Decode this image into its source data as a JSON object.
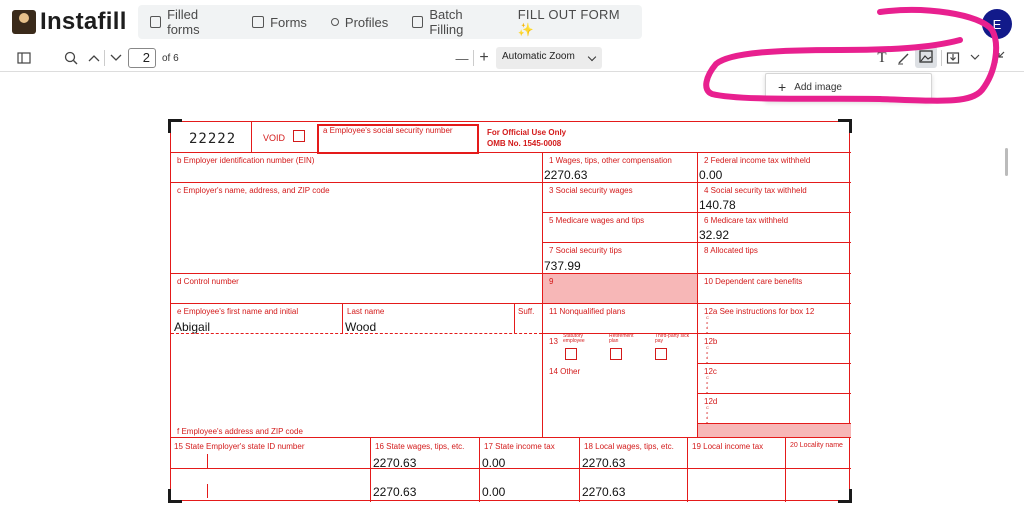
{
  "app": {
    "brand": "Instafill"
  },
  "nav": {
    "items": [
      {
        "label": "Filled forms"
      },
      {
        "label": "Forms"
      },
      {
        "label": "Profiles"
      },
      {
        "label": "Batch Filling"
      },
      {
        "label": "FILL OUT FORM ✨"
      }
    ]
  },
  "user": {
    "initial": "E"
  },
  "viewer": {
    "page": "2",
    "page_total": "of 6",
    "zoom": "Automatic Zoom",
    "popup_label": "Add image",
    "zoom_out": "—",
    "zoom_in": "+"
  },
  "form": {
    "code": "22222",
    "void_label": "VOID",
    "ssn_label": "a  Employee's social security number",
    "official_line1": "For Official Use Only",
    "official_line2": "OMB No. 1545-0008",
    "labels": {
      "b": "b  Employer identification number (EIN)",
      "c": "c  Employer's name, address, and ZIP code",
      "d": "d  Control number",
      "e": "e  Employee's first name and initial",
      "last": "Last name",
      "suff": "Suff.",
      "f": "f  Employee's address and ZIP code",
      "box1": "1   Wages, tips, other compensation",
      "box2": "2   Federal income tax withheld",
      "box3": "3   Social security wages",
      "box4": "4   Social security tax withheld",
      "box5": "5   Medicare wages and tips",
      "box6": "6   Medicare tax withheld",
      "box7": "7   Social security tips",
      "box8": "8   Allocated tips",
      "box9": "9",
      "box10": "10   Dependent care benefits",
      "box11": "11   Nonqualified plans",
      "box12a": "12a  See instructions for box 12",
      "box12b": "12b",
      "box12c": "12c",
      "box12d": "12d",
      "box13": "13",
      "statutory": "Statutory employee",
      "retirement": "Retirement plan",
      "thirdparty": "Third-party sick pay",
      "box14": "14  Other",
      "box15": "15  State    Employer's state ID number",
      "box16": "16  State wages, tips, etc.",
      "box17": "17  State income tax",
      "box18": "18  Local wages, tips, etc.",
      "box19": "19  Local income tax",
      "box20": "20  Locality name",
      "code_letters": "C o d e"
    },
    "values": {
      "box1": "2270.63",
      "box2": "0.00",
      "box4": "140.78",
      "box6": "32.92",
      "box7": "737.99",
      "first_name": "Abigail",
      "last_name": "Wood",
      "box16_row1": "2270.63",
      "box17_row1": "0.00",
      "box18_row1": "2270.63",
      "box16_row2": "2270.63",
      "box17_row2": "0.00",
      "box18_row2": "2270.63"
    }
  },
  "colors": {
    "form_red": "#e41a1a",
    "highlight": "#f7b7b7",
    "annotation": "#e8208f",
    "avatar": "#121a8a"
  }
}
